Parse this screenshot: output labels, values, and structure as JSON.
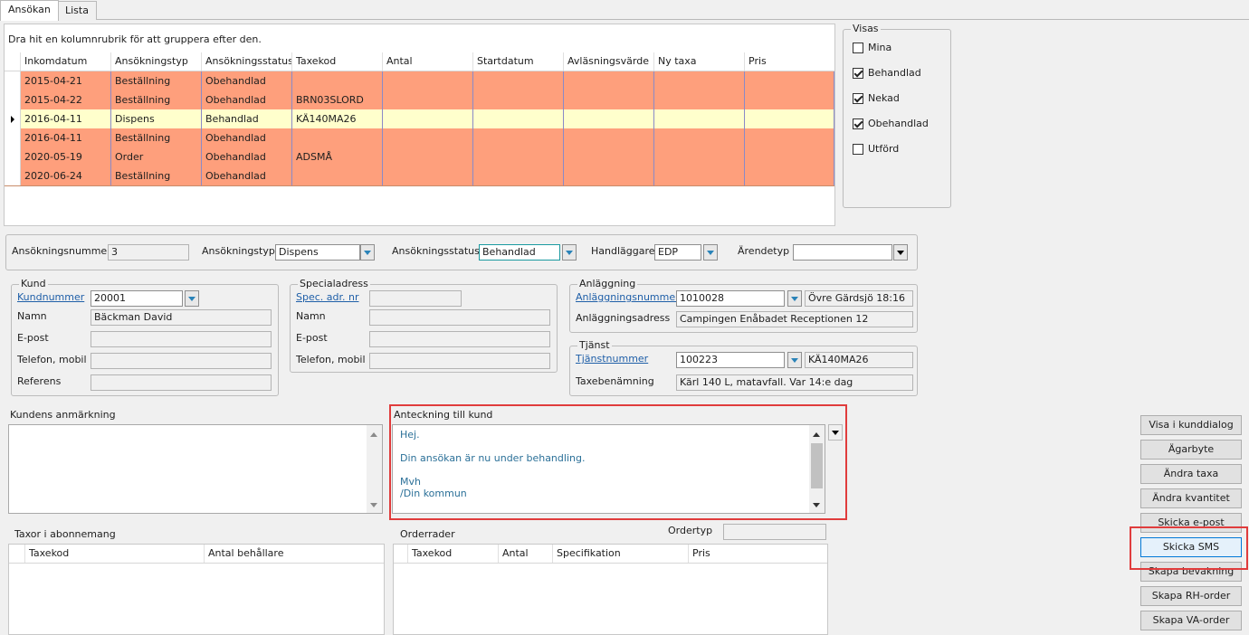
{
  "tabs": [
    "Ansökan",
    "Lista"
  ],
  "grid": {
    "group_hint": "Dra hit en kolumnrubrik för att gruppera efter den.",
    "columns": [
      "Inkomdatum",
      "Ansökningstyp",
      "Ansökningsstatus",
      "Taxekod",
      "Antal",
      "Startdatum",
      "Avläsningsvärde",
      "Ny taxa",
      "Pris"
    ],
    "rows": [
      {
        "date": "2015-04-21",
        "type": "Beställning",
        "status": "Obehandlad",
        "code": ""
      },
      {
        "date": "2015-04-22",
        "type": "Beställning",
        "status": "Obehandlad",
        "code": "BRN03SLORD"
      },
      {
        "date": "2016-04-11",
        "type": "Dispens",
        "status": "Behandlad",
        "code": "KÄ140MA26"
      },
      {
        "date": "2016-04-11",
        "type": "Beställning",
        "status": "Obehandlad",
        "code": ""
      },
      {
        "date": "2020-05-19",
        "type": "Order",
        "status": "Obehandlad",
        "code": "ADSMÅ"
      },
      {
        "date": "2020-06-24",
        "type": "Beställning",
        "status": "Obehandlad",
        "code": ""
      }
    ],
    "selected_row": 2,
    "row_color_unhandled": "#fe9f7c",
    "row_color_selected": "#ffffcc"
  },
  "visas": {
    "title": "Visas",
    "items": [
      {
        "label": "Mina",
        "checked": false
      },
      {
        "label": "Behandlad",
        "checked": true
      },
      {
        "label": "Nekad",
        "checked": true
      },
      {
        "label": "Obehandlad",
        "checked": true
      },
      {
        "label": "Utförd",
        "checked": false
      }
    ]
  },
  "appbar": {
    "nummer_label": "Ansökningsnummer",
    "nummer": "3",
    "typ_label": "Ansökningstyp",
    "typ": "Dispens",
    "status_label": "Ansökningsstatus",
    "status": "Behandlad",
    "handl_label": "Handläggare",
    "handl": "EDP",
    "arende_label": "Ärendetyp",
    "arende": ""
  },
  "kund": {
    "title": "Kund",
    "kundnummer_label": "Kundnummer",
    "kundnummer": "20001",
    "namn_label": "Namn",
    "namn": "Bäckman David",
    "epost_label": "E-post",
    "epost": "",
    "tel_label": "Telefon, mobil",
    "tel": "",
    "ref_label": "Referens",
    "ref": ""
  },
  "spec": {
    "title": "Specialadress",
    "nr_label": "Spec. adr. nr",
    "nr": "",
    "namn_label": "Namn",
    "namn": "",
    "epost_label": "E-post",
    "epost": "",
    "tel_label": "Telefon, mobil",
    "tel": ""
  },
  "anlaggning": {
    "title": "Anläggning",
    "nummer_label": "Anläggningsnummer",
    "nummer": "1010028",
    "place": "Övre Gärdsjö 18:16",
    "adress_label": "Anläggningsadress",
    "adress": "Campingen Enåbadet Receptionen 12"
  },
  "tjanst": {
    "title": "Tjänst",
    "nummer_label": "Tjänstnummer",
    "nummer": "100223",
    "code": "KÄ140MA26",
    "taxe_label": "Taxebenämning",
    "taxe": "Kärl 140 L, matavfall. Var 14:e dag"
  },
  "kundens_anmarkning_label": "Kundens anmärkning",
  "anteckning": {
    "label": "Anteckning till kund",
    "lines": [
      "Hej.",
      "",
      "Din ansökan är nu under behandling.",
      "",
      "Mvh",
      "/Din kommun"
    ]
  },
  "taxor": {
    "title": "Taxor i abonnemang",
    "columns": [
      "Taxekod",
      "Antal behållare"
    ]
  },
  "orderrader": {
    "title": "Orderrader",
    "ordertyp_label": "Ordertyp",
    "columns": [
      "Taxekod",
      "Antal",
      "Specifikation",
      "Pris"
    ]
  },
  "buttons": [
    "Visa i kunddialog",
    "Ägarbyte",
    "Ändra taxa",
    "Ändra kvantitet",
    "Skicka e-post",
    "Skicka SMS",
    "Skapa bevakning",
    "Skapa RH-order",
    "Skapa VA-order"
  ]
}
